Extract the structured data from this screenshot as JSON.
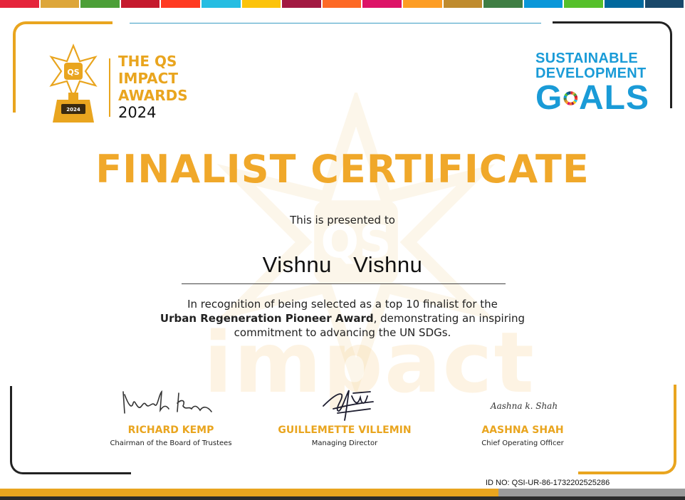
{
  "strip_colors": [
    "#e5243b",
    "#dda63a",
    "#4c9f38",
    "#c5192d",
    "#ff3a21",
    "#26bde2",
    "#fcc30b",
    "#a21942",
    "#fd6925",
    "#dd1367",
    "#fd9d24",
    "#bf8b2e",
    "#3f7e44",
    "#0a97d9",
    "#56c02b",
    "#00689d",
    "#19486a"
  ],
  "accent_color": "#e9a51f",
  "qs_logo": {
    "badge": "QS",
    "base_year": "2024",
    "title_lines": [
      "THE QS",
      "IMPACT",
      "AWARDS"
    ],
    "year": "2024"
  },
  "sdg_logo": {
    "line1": "SUSTAINABLE",
    "line2": "DEVELOPMENT",
    "goals_left": "G",
    "goals_right": "ALS"
  },
  "certificate": {
    "title": "FINALIST CERTIFICATE",
    "presented_to": "This is presented to",
    "recipient": "Vishnu  Vishnu",
    "recognition_line1": "In recognition of being selected as a top 10 finalist for the",
    "award_name": "Urban Regeneration Pioneer Award",
    "recognition_line2_rest": ", demonstrating an inspiring",
    "recognition_line3": "commitment to advancing the UN SDGs."
  },
  "watermark": {
    "badge": "QS",
    "word": "impact"
  },
  "signatories": [
    {
      "name": "RICHARD KEMP",
      "role": "Chairman of the Board of Trustees"
    },
    {
      "name": "GUILLEMETTE VILLEMIN",
      "role": "Managing Director"
    },
    {
      "name": "AASHNA SHAH",
      "role": "Chief Operating Officer",
      "signature_text": "Aashna k. Shah"
    }
  ],
  "id_number": "ID NO: QSI-UR-86-1732202525286"
}
